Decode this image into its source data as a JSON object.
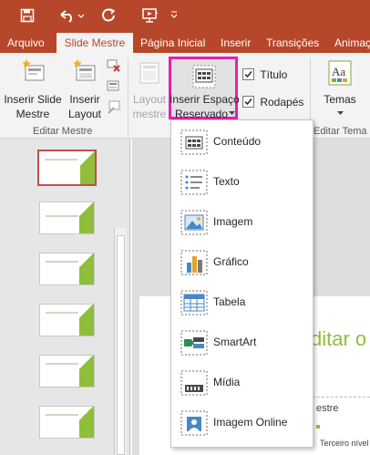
{
  "tabs": [
    {
      "label": "Arquivo",
      "active": false
    },
    {
      "label": "Slide Mestre",
      "active": true
    },
    {
      "label": "Página Inicial",
      "active": false
    },
    {
      "label": "Inserir",
      "active": false
    },
    {
      "label": "Transições",
      "active": false
    },
    {
      "label": "Animaç",
      "active": false
    }
  ],
  "ribbon": {
    "insert_slide_master": [
      "Inserir Slide",
      "Mestre"
    ],
    "insert_layout": [
      "Inserir",
      "Layout"
    ],
    "layout_master": [
      "Layout",
      "mestre"
    ],
    "insert_placeholder": [
      "Inserir Espaço",
      "Reservado"
    ],
    "title_checkbox": "Título",
    "footer_checkbox": "Rodapés",
    "themes": "Temas",
    "group_edit_master": "Editar Mestre",
    "group_edit_theme": "Editar Tema"
  },
  "placeholder_menu": [
    {
      "label": "Conteúdo",
      "icon": "content-placeholder-icon"
    },
    {
      "label": "Texto",
      "icon": "text-placeholder-icon"
    },
    {
      "label": "Imagem",
      "icon": "picture-placeholder-icon"
    },
    {
      "label": "Gráfico",
      "icon": "chart-placeholder-icon"
    },
    {
      "label": "Tabela",
      "icon": "table-placeholder-icon"
    },
    {
      "label": "SmartArt",
      "icon": "smartart-placeholder-icon"
    },
    {
      "label": "Mídia",
      "icon": "media-placeholder-icon"
    },
    {
      "label": "Imagem Online",
      "icon": "online-picture-placeholder-icon"
    }
  ],
  "slide": {
    "title_fragment": "ditar o",
    "bullet1": "estre",
    "bullet2": "Terceiro nível"
  },
  "colors": {
    "accent": "#b7472a",
    "highlight": "#e520b0",
    "slide_green": "#8fbf3a"
  }
}
